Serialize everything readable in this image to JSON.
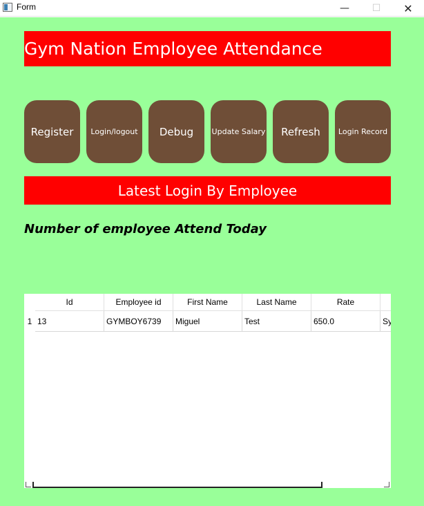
{
  "window": {
    "title": "Form",
    "minimize_glyph": "—",
    "maximize_glyph": "☐",
    "close_glyph": "✕",
    "icon": "form-app-icon"
  },
  "header": {
    "title": "Gym Nation Employee Attendance",
    "color": "#ff0000"
  },
  "nav_buttons": [
    {
      "label": "Register"
    },
    {
      "label": "Login/logout"
    },
    {
      "label": "Debug"
    },
    {
      "label": "Update Salary"
    },
    {
      "label": "Refresh"
    },
    {
      "label": "Login Record"
    }
  ],
  "sub_header": {
    "title": "Latest Login By Employee"
  },
  "attendance_label": "Number of employee Attend Today",
  "table": {
    "columns": [
      "Id",
      "Employee id",
      "First Name",
      "Last Name",
      "Rate",
      ""
    ],
    "rows": [
      {
        "row_number": "1",
        "cells": [
          "13",
          "GYMBOY6739",
          "Miguel",
          "Test",
          "650.0",
          "Sy"
        ]
      }
    ]
  },
  "colors": {
    "background": "#99ff99",
    "banner": "#ff0000",
    "button": "#6f4e37"
  }
}
